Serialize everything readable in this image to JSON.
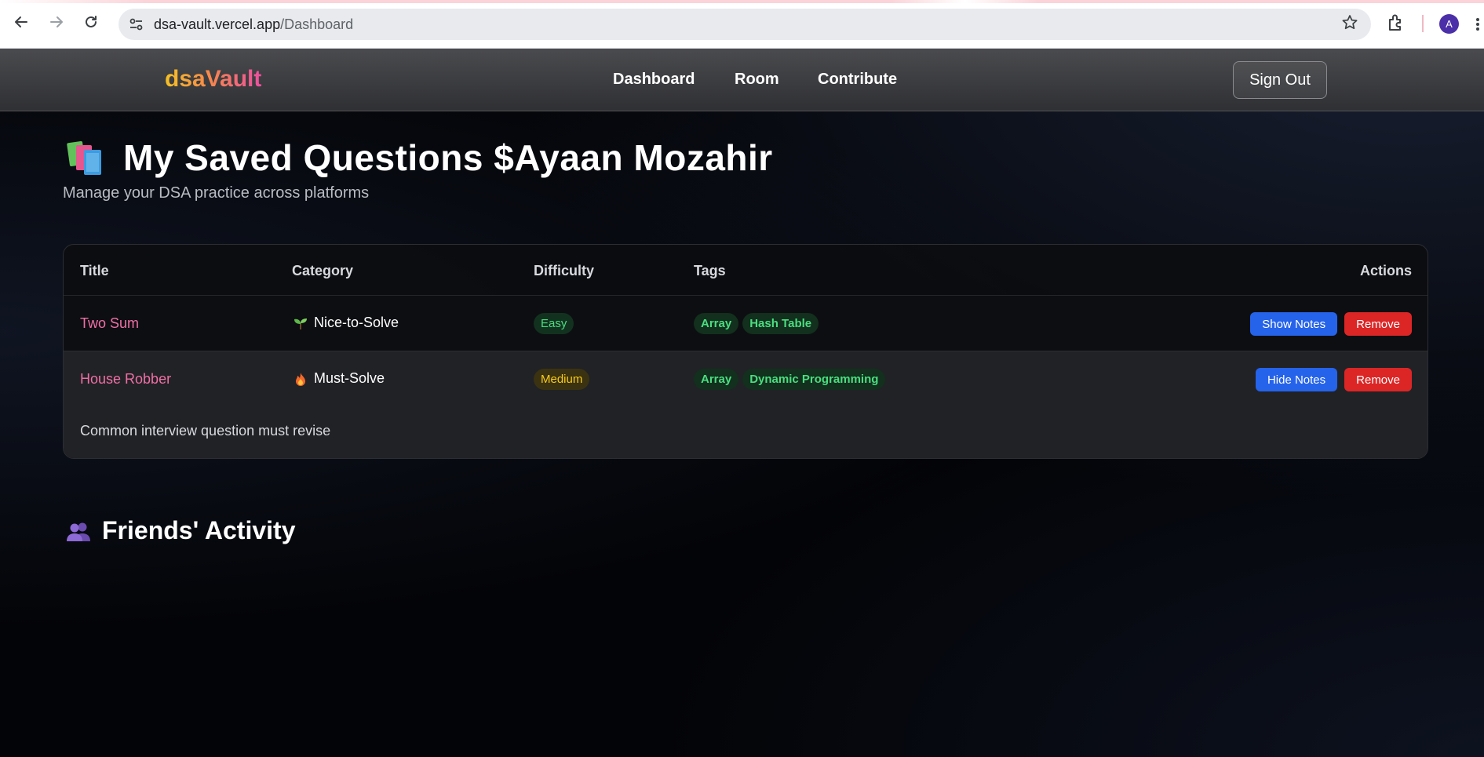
{
  "browser": {
    "url_host": "dsa-vault.vercel.app",
    "url_path": "/Dashboard",
    "profile_initial": "A",
    "icons": [
      "back-arrow-icon",
      "forward-arrow-icon",
      "reload-icon",
      "site-info-icon",
      "star-icon",
      "extensions-icon",
      "menu-icon"
    ]
  },
  "header": {
    "logo": "dsaVault",
    "nav": [
      "Dashboard",
      "Room",
      "Contribute"
    ],
    "sign_out": "Sign Out"
  },
  "main": {
    "title": "My Saved Questions $Ayaan Mozahir",
    "subtitle": "Manage your DSA practice across platforms",
    "table": {
      "columns": [
        "Title",
        "Category",
        "Difficulty",
        "Tags",
        "Actions"
      ],
      "rows": [
        {
          "title": "Two Sum",
          "category": "Nice-to-Solve",
          "category_icon": "seedling-icon",
          "difficulty": "Easy",
          "tags": [
            "Array",
            "Hash Table"
          ],
          "notes_button": "Show Notes",
          "remove_button": "Remove"
        },
        {
          "title": "House Robber",
          "category": "Must-Solve",
          "category_icon": "fire-icon",
          "difficulty": "Medium",
          "tags": [
            "Array",
            "Dynamic Programming"
          ],
          "notes_button": "Hide Notes",
          "remove_button": "Remove",
          "note": "Common interview question must revise"
        }
      ]
    },
    "friends_title": "Friends' Activity"
  },
  "colors": {
    "accent_pink": "#f06fa5",
    "button_blue": "#2563eb",
    "button_red": "#dc2626",
    "easy_green": "#4ade80",
    "medium_yellow": "#facc15"
  }
}
